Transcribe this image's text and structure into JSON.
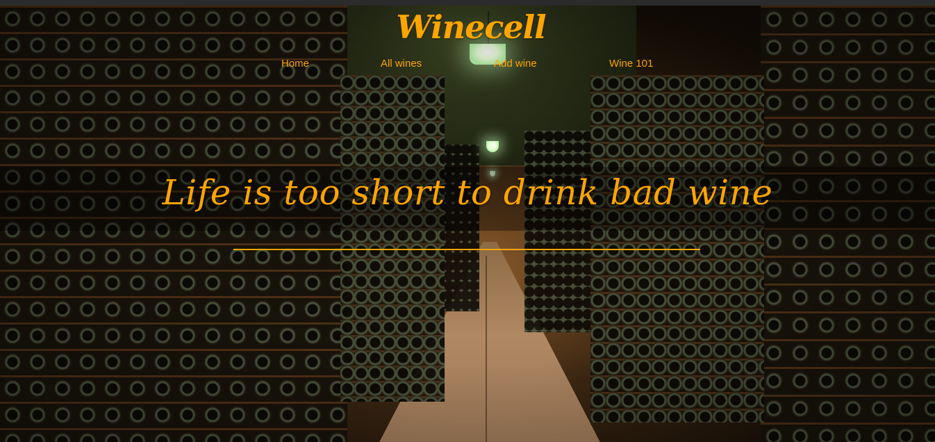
{
  "brand": {
    "name": "Winecell",
    "accent_color": "#ffa500"
  },
  "nav": {
    "items": [
      {
        "label": "Home"
      },
      {
        "label": "All wines"
      },
      {
        "label": "Add wine"
      },
      {
        "label": "Wine 101"
      }
    ]
  },
  "hero": {
    "tagline": "Life is too short to drink bad wine",
    "background": "wine-cellar-photo"
  }
}
